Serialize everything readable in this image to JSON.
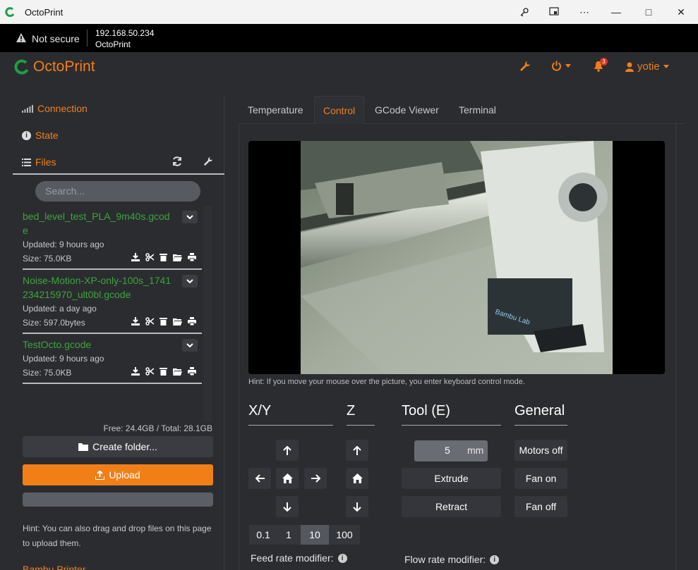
{
  "window": {
    "title": "OctoPrint",
    "key_icon": "key-icon",
    "cast_icon": "cast-icon",
    "more_glyph": "⋯",
    "minimize_glyph": "—",
    "maximize_glyph": "□",
    "close_glyph": "✕"
  },
  "address": {
    "security": "Not secure",
    "host": "192.168.50.234",
    "page_title": "OctoPrint"
  },
  "navbar": {
    "brand": "OctoPrint",
    "notification_count": "3",
    "user": "yotie",
    "accent": "#f07f18"
  },
  "sidebar": {
    "connection": "Connection",
    "state": "State",
    "files": "Files",
    "search_placeholder": "Search...",
    "files_list": [
      {
        "name": "bed_level_test_PLA_9m40s.gcode",
        "updated": "Updated: 9 hours ago",
        "size": "Size: 75.0KB"
      },
      {
        "name": "Noise-Motion-XP-only-100s_1741234215970_ult0bl.gcode",
        "updated": "Updated: a day ago",
        "size": "Size: 597.0bytes"
      },
      {
        "name": "TestOcto.gcode",
        "updated": "Updated: 9 hours ago",
        "size": "Size: 75.0KB"
      }
    ],
    "free_total": "Free: 24.4GB / Total: 28.1GB",
    "create_folder": "Create folder...",
    "upload": "Upload",
    "hint": "Hint: You can also drag and drop files on this page to upload them.",
    "next_section": "Bambu Printer"
  },
  "tabs": [
    "Temperature",
    "Control",
    "GCode Viewer",
    "Terminal"
  ],
  "control": {
    "webcam_hint": "Hint: If you move your mouse over the picture, you enter keyboard control mode.",
    "xy_label": "X/Y",
    "z_label": "Z",
    "tool_label": "Tool (E)",
    "general_label": "General",
    "extrude_amount": "5",
    "extrude_unit": "mm",
    "extrude": "Extrude",
    "retract": "Retract",
    "motors_off": "Motors off",
    "fan_on": "Fan on",
    "fan_off": "Fan off",
    "steps": [
      "0.1",
      "1",
      "10",
      "100"
    ],
    "active_step": "10",
    "feed_rate": "Feed rate modifier:",
    "flow_rate": "Flow rate modifier:"
  }
}
